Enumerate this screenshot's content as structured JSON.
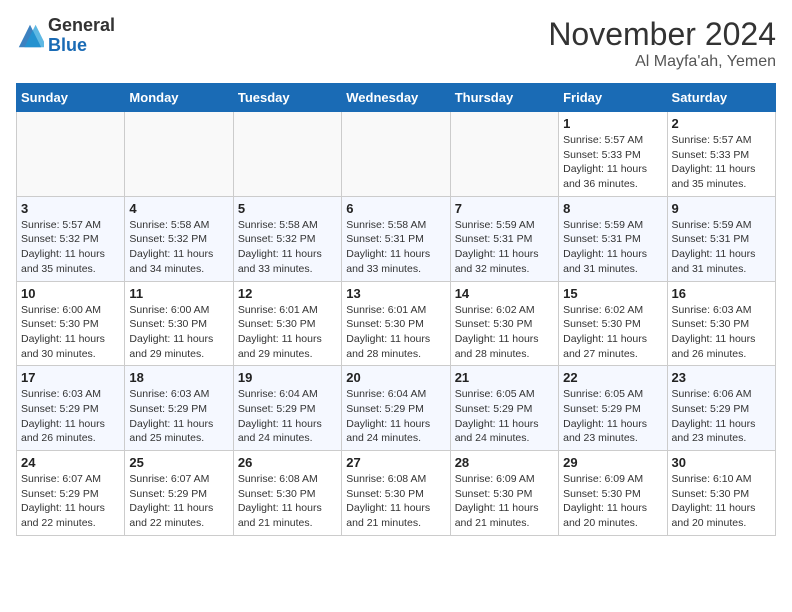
{
  "header": {
    "logo_line1": "General",
    "logo_line2": "Blue",
    "month": "November 2024",
    "location": "Al Mayfa'ah, Yemen"
  },
  "days_of_week": [
    "Sunday",
    "Monday",
    "Tuesday",
    "Wednesday",
    "Thursday",
    "Friday",
    "Saturday"
  ],
  "weeks": [
    [
      {
        "day": "",
        "info": ""
      },
      {
        "day": "",
        "info": ""
      },
      {
        "day": "",
        "info": ""
      },
      {
        "day": "",
        "info": ""
      },
      {
        "day": "",
        "info": ""
      },
      {
        "day": "1",
        "info": "Sunrise: 5:57 AM\nSunset: 5:33 PM\nDaylight: 11 hours\nand 36 minutes."
      },
      {
        "day": "2",
        "info": "Sunrise: 5:57 AM\nSunset: 5:33 PM\nDaylight: 11 hours\nand 35 minutes."
      }
    ],
    [
      {
        "day": "3",
        "info": "Sunrise: 5:57 AM\nSunset: 5:32 PM\nDaylight: 11 hours\nand 35 minutes."
      },
      {
        "day": "4",
        "info": "Sunrise: 5:58 AM\nSunset: 5:32 PM\nDaylight: 11 hours\nand 34 minutes."
      },
      {
        "day": "5",
        "info": "Sunrise: 5:58 AM\nSunset: 5:32 PM\nDaylight: 11 hours\nand 33 minutes."
      },
      {
        "day": "6",
        "info": "Sunrise: 5:58 AM\nSunset: 5:31 PM\nDaylight: 11 hours\nand 33 minutes."
      },
      {
        "day": "7",
        "info": "Sunrise: 5:59 AM\nSunset: 5:31 PM\nDaylight: 11 hours\nand 32 minutes."
      },
      {
        "day": "8",
        "info": "Sunrise: 5:59 AM\nSunset: 5:31 PM\nDaylight: 11 hours\nand 31 minutes."
      },
      {
        "day": "9",
        "info": "Sunrise: 5:59 AM\nSunset: 5:31 PM\nDaylight: 11 hours\nand 31 minutes."
      }
    ],
    [
      {
        "day": "10",
        "info": "Sunrise: 6:00 AM\nSunset: 5:30 PM\nDaylight: 11 hours\nand 30 minutes."
      },
      {
        "day": "11",
        "info": "Sunrise: 6:00 AM\nSunset: 5:30 PM\nDaylight: 11 hours\nand 29 minutes."
      },
      {
        "day": "12",
        "info": "Sunrise: 6:01 AM\nSunset: 5:30 PM\nDaylight: 11 hours\nand 29 minutes."
      },
      {
        "day": "13",
        "info": "Sunrise: 6:01 AM\nSunset: 5:30 PM\nDaylight: 11 hours\nand 28 minutes."
      },
      {
        "day": "14",
        "info": "Sunrise: 6:02 AM\nSunset: 5:30 PM\nDaylight: 11 hours\nand 28 minutes."
      },
      {
        "day": "15",
        "info": "Sunrise: 6:02 AM\nSunset: 5:30 PM\nDaylight: 11 hours\nand 27 minutes."
      },
      {
        "day": "16",
        "info": "Sunrise: 6:03 AM\nSunset: 5:30 PM\nDaylight: 11 hours\nand 26 minutes."
      }
    ],
    [
      {
        "day": "17",
        "info": "Sunrise: 6:03 AM\nSunset: 5:29 PM\nDaylight: 11 hours\nand 26 minutes."
      },
      {
        "day": "18",
        "info": "Sunrise: 6:03 AM\nSunset: 5:29 PM\nDaylight: 11 hours\nand 25 minutes."
      },
      {
        "day": "19",
        "info": "Sunrise: 6:04 AM\nSunset: 5:29 PM\nDaylight: 11 hours\nand 24 minutes."
      },
      {
        "day": "20",
        "info": "Sunrise: 6:04 AM\nSunset: 5:29 PM\nDaylight: 11 hours\nand 24 minutes."
      },
      {
        "day": "21",
        "info": "Sunrise: 6:05 AM\nSunset: 5:29 PM\nDaylight: 11 hours\nand 24 minutes."
      },
      {
        "day": "22",
        "info": "Sunrise: 6:05 AM\nSunset: 5:29 PM\nDaylight: 11 hours\nand 23 minutes."
      },
      {
        "day": "23",
        "info": "Sunrise: 6:06 AM\nSunset: 5:29 PM\nDaylight: 11 hours\nand 23 minutes."
      }
    ],
    [
      {
        "day": "24",
        "info": "Sunrise: 6:07 AM\nSunset: 5:29 PM\nDaylight: 11 hours\nand 22 minutes."
      },
      {
        "day": "25",
        "info": "Sunrise: 6:07 AM\nSunset: 5:29 PM\nDaylight: 11 hours\nand 22 minutes."
      },
      {
        "day": "26",
        "info": "Sunrise: 6:08 AM\nSunset: 5:30 PM\nDaylight: 11 hours\nand 21 minutes."
      },
      {
        "day": "27",
        "info": "Sunrise: 6:08 AM\nSunset: 5:30 PM\nDaylight: 11 hours\nand 21 minutes."
      },
      {
        "day": "28",
        "info": "Sunrise: 6:09 AM\nSunset: 5:30 PM\nDaylight: 11 hours\nand 21 minutes."
      },
      {
        "day": "29",
        "info": "Sunrise: 6:09 AM\nSunset: 5:30 PM\nDaylight: 11 hours\nand 20 minutes."
      },
      {
        "day": "30",
        "info": "Sunrise: 6:10 AM\nSunset: 5:30 PM\nDaylight: 11 hours\nand 20 minutes."
      }
    ]
  ]
}
